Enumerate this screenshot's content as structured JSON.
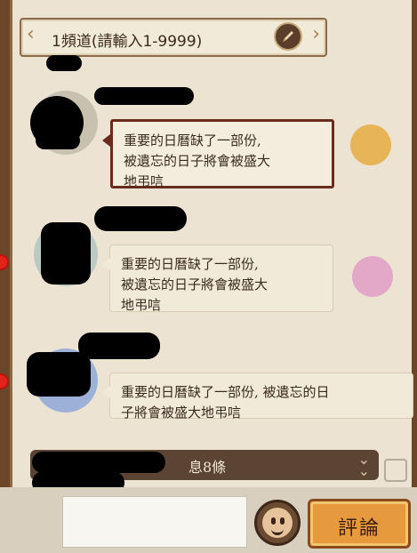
{
  "channel": {
    "label": "1頻道(請輸入1-9999)"
  },
  "messages": [
    {
      "text_lines": [
        "重要的日曆缺了一部份,",
        "被遺忘的日子將會被盛大",
        "地弔唁"
      ],
      "selected": true
    },
    {
      "text_lines": [
        "重要的日曆缺了一部份,",
        "被遺忘的日子將會被盛大",
        "地弔唁"
      ],
      "selected": false
    },
    {
      "text_lines": [
        "重要的日曆缺了一部份,  被遺忘的日",
        "子將會被盛大地弔唁"
      ],
      "selected": false
    }
  ],
  "notice": {
    "text": "息8條"
  },
  "comment_button": {
    "label": "評論"
  },
  "icons": [
    "pencil-icon",
    "double-chevron-down-icon",
    "expand-icon",
    "emoji-face-icon"
  ],
  "colors": {
    "frame": "#6b4628",
    "panel": "#ece3d2",
    "selected_border": "#6a2a1c",
    "comment_button": "#e79a3d",
    "unread_dot": "#e0241a"
  }
}
